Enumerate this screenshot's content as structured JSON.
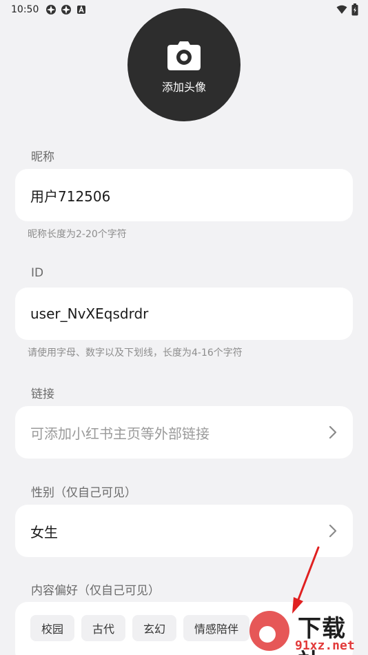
{
  "status_bar": {
    "time": "10:50",
    "icons_left": [
      "app-icon",
      "app-icon",
      "notification-a-icon"
    ],
    "icons_right": [
      "wifi-icon",
      "battery-icon"
    ]
  },
  "avatar": {
    "label": "添加头像",
    "icon": "camera-icon"
  },
  "nickname": {
    "title": "昵称",
    "value": "用户712506",
    "hint": "昵称长度为2-20个字符"
  },
  "id_field": {
    "title": "ID",
    "value": "user_NvXEqsdrdr",
    "hint": "请使用字母、数字以及下划线，长度为4-16个字符"
  },
  "link": {
    "title": "链接",
    "placeholder": "可添加小红书主页等外部链接"
  },
  "gender": {
    "title": "性别（仅自己可见）",
    "value": "女生"
  },
  "preferences": {
    "title": "内容偏好（仅自己可见）",
    "tags": [
      "校园",
      "古代",
      "玄幻",
      "情感陪伴"
    ]
  },
  "watermark": {
    "main": "下载站",
    "sub": "91xz.net"
  },
  "colors": {
    "background": "#f2f2f4",
    "card": "#ffffff",
    "avatar_bg": "#2d2d2d",
    "arrow": "#e02020"
  }
}
